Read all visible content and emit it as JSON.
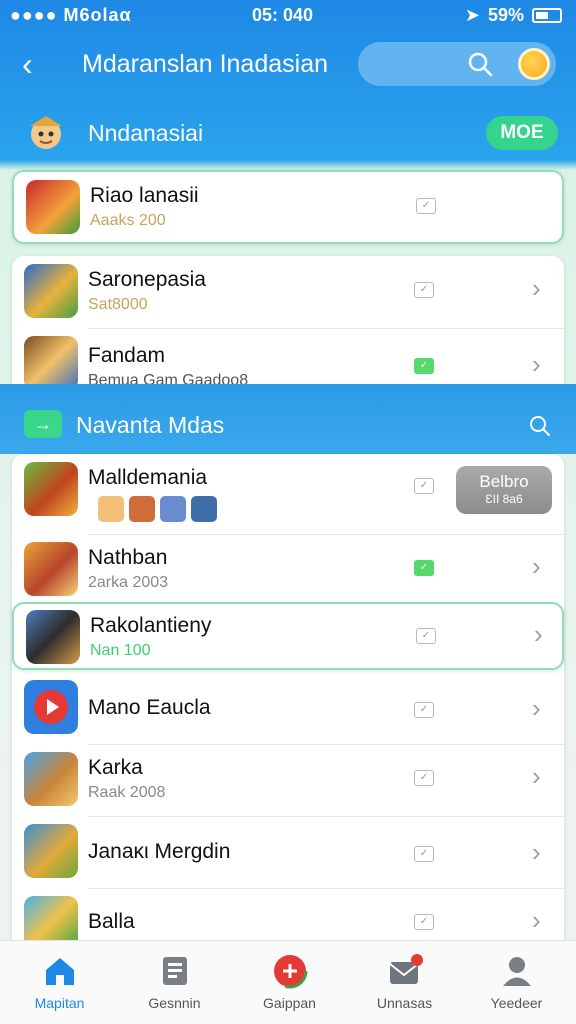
{
  "status": {
    "carrier": "●●●● M6olaα",
    "time": "05: 040",
    "battery": "59%"
  },
  "header": {
    "title": "Mdaranslan Inadasian",
    "back_label": "‹"
  },
  "section1": {
    "title": "Nndanasiai",
    "more_label": "MOE",
    "items": [
      {
        "name": "Riao lanasii",
        "sub": "Aaaks 200",
        "check": "✓"
      },
      {
        "name": "Saronepasia",
        "sub": "Sat8000",
        "check": "✓"
      },
      {
        "name": "Fandam",
        "sub": "Bemua Gam  Gaadoo8",
        "check": "✓"
      }
    ]
  },
  "section2": {
    "title": "Navanta Mdas",
    "badge": {
      "line1": "Belbro",
      "line2": "ƐII 8a6"
    },
    "items": [
      {
        "name": "Malldemania",
        "sub": "",
        "check": "✓"
      },
      {
        "name": "Nathban",
        "sub": "2arka 2003",
        "check": "✓"
      },
      {
        "name": "Rakolantieny",
        "sub": "Nan 100",
        "check": "✓"
      },
      {
        "name": "Mano Eaucla",
        "sub": "",
        "check": "✓"
      },
      {
        "name": "Karka",
        "sub": "Raak 2008",
        "check": "✓"
      },
      {
        "name": "Janaκι Mergdin",
        "sub": "",
        "check": "✓"
      },
      {
        "name": "Balla",
        "sub": "",
        "check": "✓"
      }
    ]
  },
  "tabs": [
    {
      "label": "Mapitan",
      "icon": "home-icon"
    },
    {
      "label": "Gesnnin",
      "icon": "document-icon"
    },
    {
      "label": "Gaippan",
      "icon": "game-icon"
    },
    {
      "label": "Unnasas",
      "icon": "mail-icon"
    },
    {
      "label": "Yeedeer",
      "icon": "profile-icon"
    }
  ],
  "colors": {
    "primary": "#1e88e5",
    "accent_green": "#35d48d",
    "highlight_border": "#8fe0b4"
  }
}
